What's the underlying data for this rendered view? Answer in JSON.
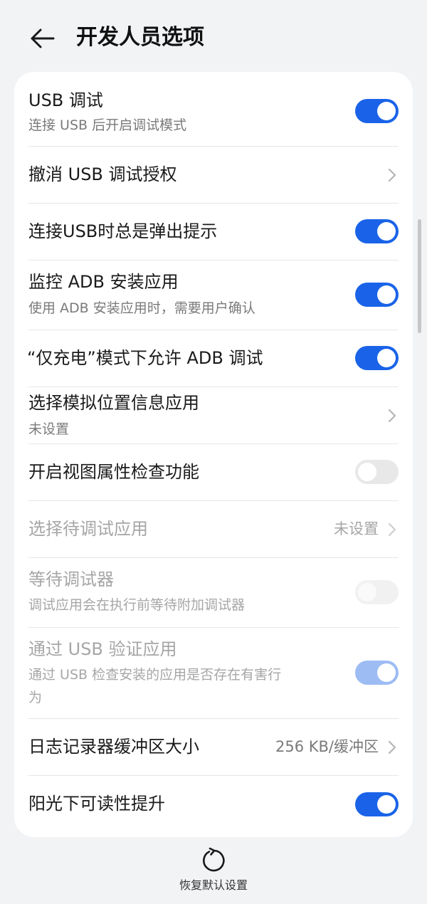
{
  "header": {
    "title": "开发人员选项",
    "back_icon": "arrow-left-icon"
  },
  "settings": [
    {
      "title": "USB 调试",
      "subtitle": "连接 USB 后开启调试模式",
      "control": "toggle",
      "state": "on"
    },
    {
      "title": "撤消 USB 调试授权",
      "control": "chevron"
    },
    {
      "title": "连接USB时总是弹出提示",
      "control": "toggle",
      "state": "on"
    },
    {
      "title": "监控 ADB 安装应用",
      "subtitle": "使用 ADB 安装应用时，需要用户确认",
      "control": "toggle",
      "state": "on"
    },
    {
      "title": "“仅充电”模式下允许 ADB 调试",
      "control": "toggle",
      "state": "on"
    },
    {
      "title": "选择模拟位置信息应用",
      "subtitle": "未设置",
      "control": "chevron"
    },
    {
      "title": "开启视图属性检查功能",
      "control": "toggle",
      "state": "off"
    },
    {
      "title": "选择待调试应用",
      "value": "未设置",
      "control": "chevron",
      "disabled": true
    },
    {
      "title": "等待调试器",
      "subtitle": "调试应用会在执行前等待附加调试器",
      "control": "toggle",
      "state": "off",
      "disabled": true
    },
    {
      "title": "通过 USB 验证应用",
      "subtitle_line1": "通过 USB 检查安装的应用是否存在有害行",
      "subtitle_line2": "为",
      "control": "toggle",
      "state": "on",
      "disabled": true
    },
    {
      "title": "日志记录器缓冲区大小",
      "value": "256 KB/缓冲区",
      "control": "chevron"
    },
    {
      "title": "阳光下可读性提升",
      "control": "toggle",
      "state": "on"
    }
  ],
  "footer": {
    "reset_label": "恢复默认设置",
    "reset_icon": "refresh-icon"
  },
  "colors": {
    "accent": "#1a63e8",
    "background": "#f1f3f5",
    "card": "#ffffff"
  }
}
